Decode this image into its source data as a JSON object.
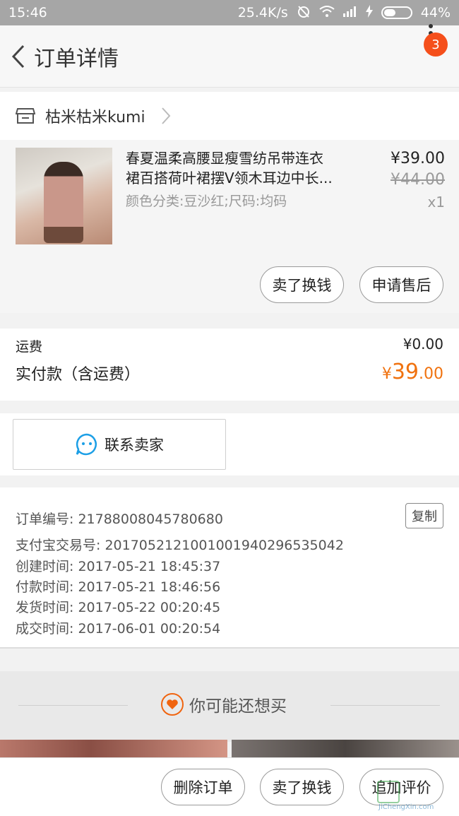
{
  "status_bar": {
    "time": "15:46",
    "speed": "25.4K/s",
    "battery": "44%"
  },
  "nav": {
    "title": "订单详情",
    "badge": "3"
  },
  "shop": {
    "name": "枯米枯米kumi"
  },
  "product": {
    "title_line1": "春夏温柔高腰显瘦雪纺吊带连衣",
    "title_line2": "裙百搭荷叶裙摆V领木耳边中长...",
    "spec": "颜色分类:豆沙红;尺码:均码",
    "price": "¥39.00",
    "original_price": "¥44.00",
    "quantity": "x1",
    "actions": {
      "sell": "卖了换钱",
      "after_sale": "申请售后"
    }
  },
  "fees": {
    "shipping_label": "运费",
    "shipping_value": "¥0.00",
    "paid_label": "实付款（含运费）",
    "paid_currency": "¥",
    "paid_int": "39",
    "paid_dec": ".00"
  },
  "contact": {
    "label": "联系卖家"
  },
  "order_info": {
    "copy_label": "复制",
    "lines": [
      "订单编号: 21788008045780680",
      "支付宝交易号: 2017052121001001940296535042",
      "创建时间: 2017-05-21 18:45:37",
      "付款时间: 2017-05-21 18:46:56",
      "发货时间: 2017-05-22 00:20:45",
      "成交时间: 2017-06-01 00:20:54"
    ]
  },
  "recommend": {
    "title": "你可能还想买"
  },
  "bottom_bar": {
    "delete": "删除订单",
    "sell": "卖了换钱",
    "review": "追加评价"
  },
  "watermark": {
    "text": "JiChengXin.com"
  },
  "colors": {
    "accent": "#f0720f",
    "badge": "#f54f1b",
    "contact_icon": "#1c9fe6"
  },
  "icons": [
    "back-arrow-icon",
    "more-vertical-icon",
    "shop-icon",
    "chevron-right-icon",
    "chat-bubble-icon",
    "heart-icon"
  ]
}
